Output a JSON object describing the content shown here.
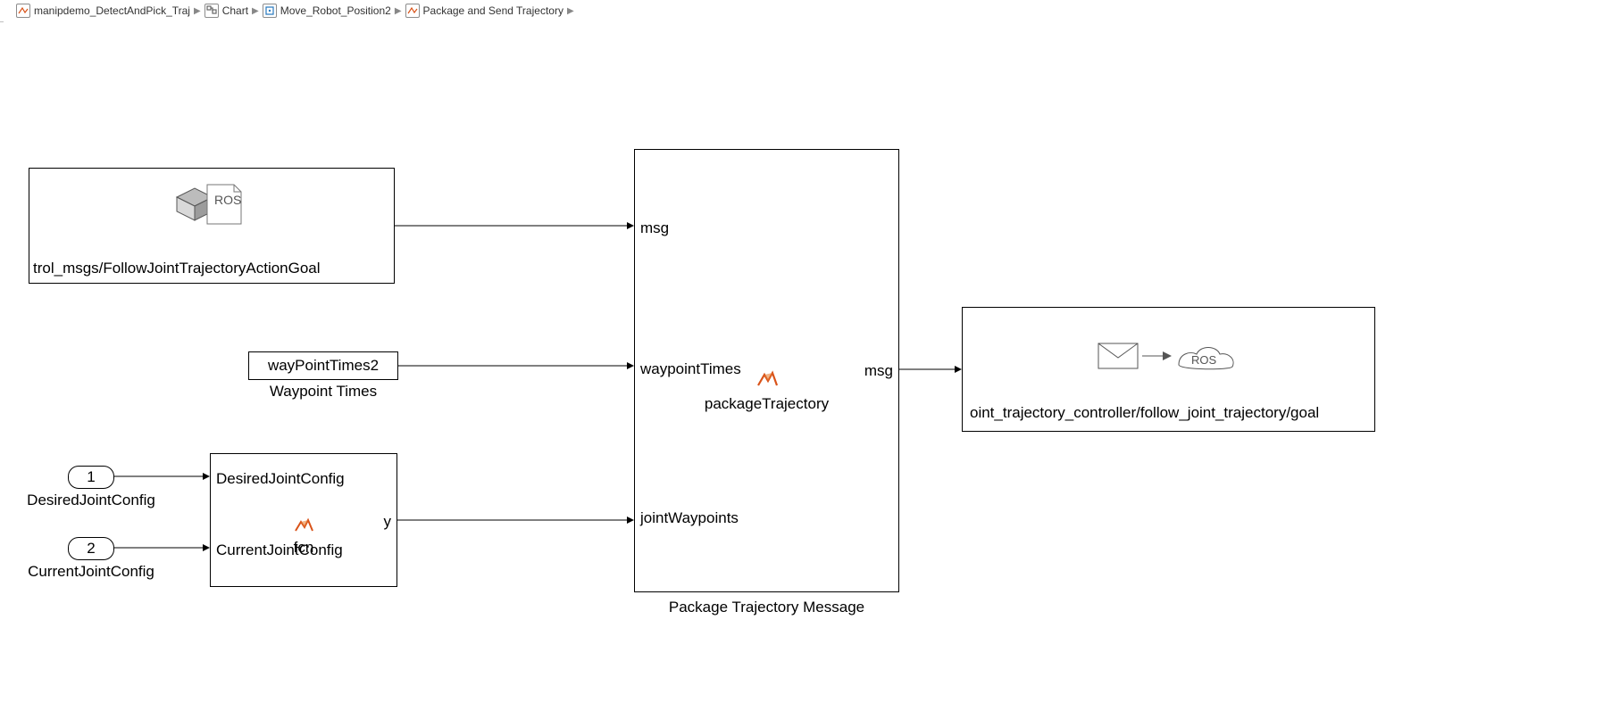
{
  "breadcrumb": {
    "items": [
      {
        "label": "manipdemo_DetectAndPick_Traj"
      },
      {
        "label": "Chart"
      },
      {
        "label": "Move_Robot_Position2"
      },
      {
        "label": "Package and Send Trajectory"
      }
    ]
  },
  "blocks": {
    "ros_blank_msg": {
      "caption": "trol_msgs/FollowJointTrajectoryActionGoal",
      "ros_label": "ROS"
    },
    "waypoint_times": {
      "value": "wayPointTimes2",
      "title": "Waypoint Times"
    },
    "fcn": {
      "in1": "DesiredJointConfig",
      "in2": "CurrentJointConfig",
      "out": "y",
      "name": "fcn"
    },
    "package_trajectory": {
      "in1": "msg",
      "in2": "waypointTimes",
      "in3": "jointWaypoints",
      "out": "msg",
      "name": "packageTrajectory",
      "title": "Package Trajectory Message"
    },
    "publish": {
      "topic": "oint_trajectory_controller/follow_joint_trajectory/goal",
      "ros_label": "ROS"
    },
    "inports": {
      "p1": {
        "num": "1",
        "label": "DesiredJointConfig"
      },
      "p2": {
        "num": "2",
        "label": "CurrentJointConfig"
      }
    }
  }
}
